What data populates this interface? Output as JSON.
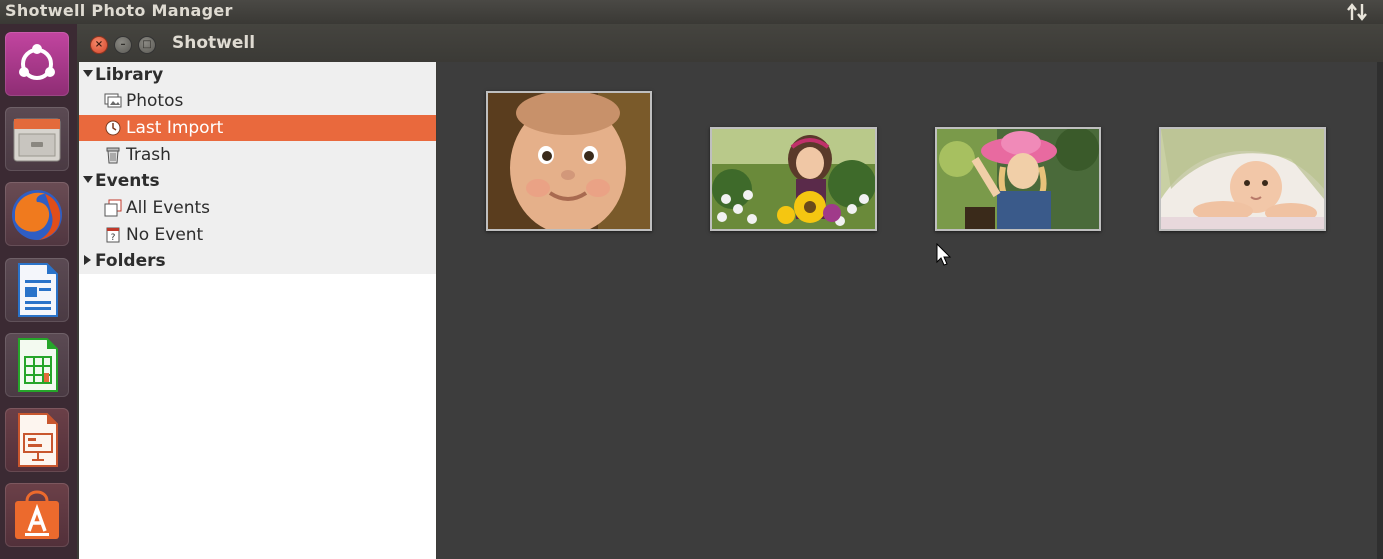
{
  "top_panel": {
    "title": "Shotwell Photo Manager",
    "network_icon": "network-transfer-icon"
  },
  "launcher": {
    "items": [
      {
        "name": "ubuntu-dash-icon"
      },
      {
        "name": "files-icon"
      },
      {
        "name": "firefox-icon"
      },
      {
        "name": "libreoffice-writer-icon"
      },
      {
        "name": "libreoffice-calc-icon"
      },
      {
        "name": "libreoffice-impress-icon"
      },
      {
        "name": "software-center-icon"
      }
    ]
  },
  "window": {
    "title": "Shotwell",
    "buttons": {
      "close": "×",
      "minimize": "–",
      "maximize": "□"
    }
  },
  "sidebar": {
    "library": {
      "label": "Library",
      "expanded": true
    },
    "photos": {
      "label": "Photos",
      "icon": "photos-icon"
    },
    "last_import": {
      "label": "Last Import",
      "icon": "last-import-icon",
      "selected": true
    },
    "trash": {
      "label": "Trash",
      "icon": "trash-icon"
    },
    "events": {
      "label": "Events",
      "expanded": true
    },
    "all_events": {
      "label": "All Events",
      "icon": "all-events-icon"
    },
    "no_event": {
      "label": "No Event",
      "icon": "no-event-icon"
    },
    "folders": {
      "label": "Folders",
      "expanded": false
    }
  },
  "photos": [
    {
      "subject": "baby-face-photo"
    },
    {
      "subject": "girl-with-sunflowers-photo"
    },
    {
      "subject": "girl-in-pink-hat-photo"
    },
    {
      "subject": "baby-under-blanket-photo"
    }
  ],
  "colors": {
    "accent": "#e9693d",
    "launcher_bg": "#3b2a33",
    "viewer_bg": "#3d3d3d"
  }
}
